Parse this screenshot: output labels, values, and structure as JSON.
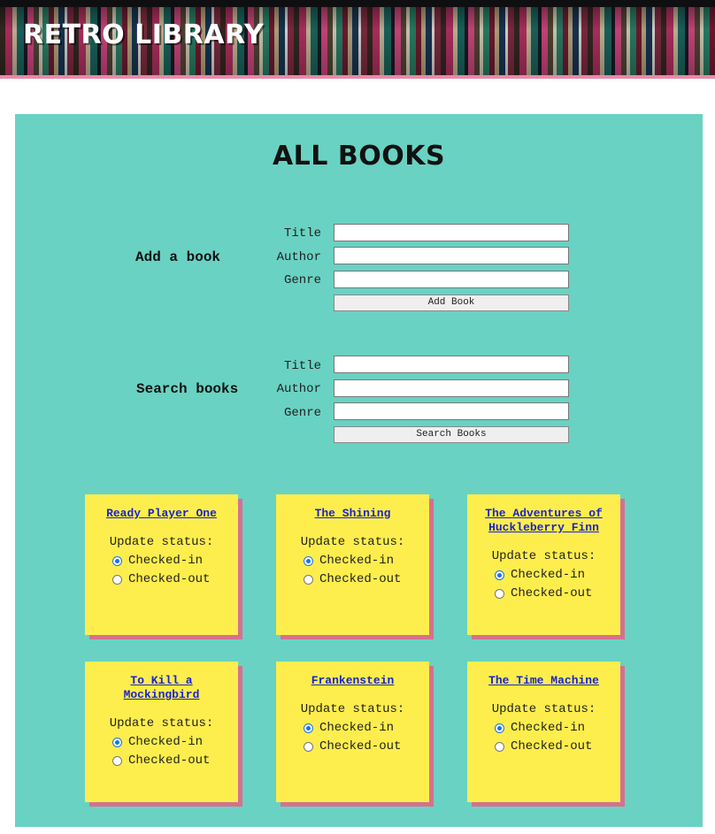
{
  "site": {
    "title": "RETRO LIBRARY"
  },
  "page": {
    "heading": "ALL BOOKS"
  },
  "add_form": {
    "label": "Add a book",
    "title_label": "Title",
    "author_label": "Author",
    "genre_label": "Genre",
    "title_value": "",
    "author_value": "",
    "genre_value": "",
    "button_label": "Add Book"
  },
  "search_form": {
    "label": "Search books",
    "title_label": "Title",
    "author_label": "Author",
    "genre_label": "Genre",
    "title_value": "",
    "author_value": "",
    "genre_value": "",
    "button_label": "Search Books"
  },
  "books": [
    {
      "title": "Ready Player One",
      "status_label": "Update status:",
      "option_in": "Checked-in",
      "option_out": "Checked-out",
      "status": "checked-in"
    },
    {
      "title": "The Shining",
      "status_label": "Update status:",
      "option_in": "Checked-in",
      "option_out": "Checked-out",
      "status": "checked-in"
    },
    {
      "title": "The Adventures of Huckleberry Finn",
      "status_label": "Update status:",
      "option_in": "Checked-in",
      "option_out": "Checked-out",
      "status": "checked-in"
    },
    {
      "title": "To Kill a Mockingbird",
      "status_label": "Update status:",
      "option_in": "Checked-in",
      "option_out": "Checked-out",
      "status": "checked-in"
    },
    {
      "title": "Frankenstein",
      "status_label": "Update status:",
      "option_in": "Checked-in",
      "option_out": "Checked-out",
      "status": "checked-in"
    },
    {
      "title": "The Time Machine",
      "status_label": "Update status:",
      "option_in": "Checked-in",
      "option_out": "Checked-out",
      "status": "checked-in"
    }
  ],
  "colors": {
    "panel": "#69d2c3",
    "card": "#fdee4d",
    "card_shadow": "#d6708f",
    "link": "#1a24c9",
    "radio_accent": "#1a73e8"
  }
}
